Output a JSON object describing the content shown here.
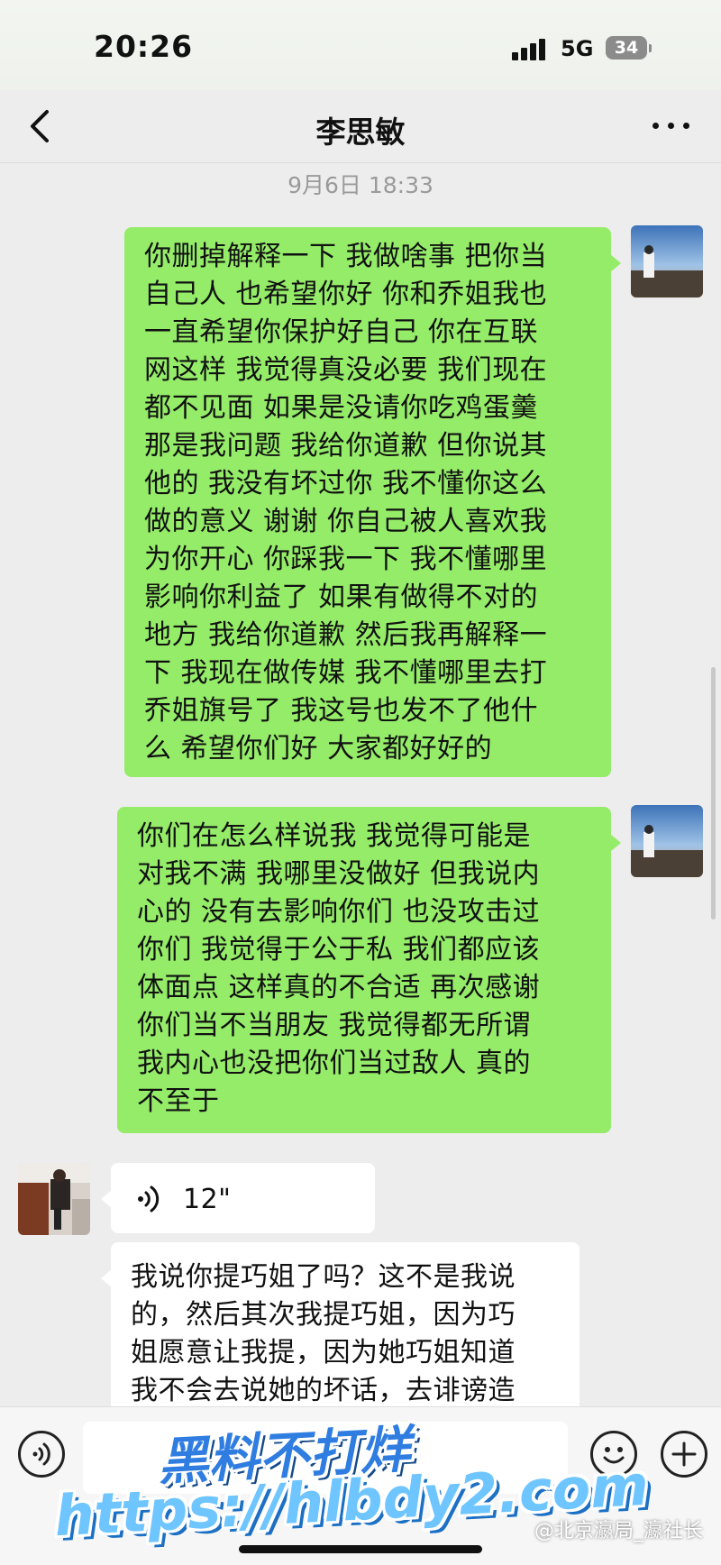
{
  "status_bar": {
    "time": "20:26",
    "network": "5G",
    "battery": "34"
  },
  "nav": {
    "title": "李思敏",
    "back_icon": "chevron-left-icon",
    "more_icon": "more-dots-icon"
  },
  "timestamp": "9月6日 18:33",
  "messages": [
    {
      "side": "sent",
      "type": "text",
      "lines": [
        "你删掉解释一下 我做啥事 把你当",
        "自己人 也希望你好 你和乔姐我也",
        "一直希望你保护好自己 你在互联",
        "网这样 我觉得真没必要 我们现在",
        "都不见面 如果是没请你吃鸡蛋羹",
        "那是我问题 我给你道歉 但你说其",
        "他的 我没有坏过你 我不懂你这么",
        "做的意义 谢谢 你自己被人喜欢我",
        "为你开心 你踩我一下 我不懂哪里",
        "影响你利益了 如果有做得不对的",
        "地方 我给你道歉 然后我再解释一",
        "下 我现在做传媒 我不懂哪里去打",
        "乔姐旗号了 我这号也发不了他什",
        "么 希望你们好 大家都好好的"
      ]
    },
    {
      "side": "sent",
      "type": "text",
      "lines": [
        "你们在怎么样说我 我觉得可能是",
        "对我不满 我哪里没做好 但我说内",
        "心的 没有去影响你们 也没攻击过",
        "你们 我觉得于公于私 我们都应该",
        "体面点 这样真的不合适 再次感谢",
        "你们当不当朋友 我觉得都无所谓",
        "我内心也没把你们当过敌人 真的",
        "不至于"
      ]
    },
    {
      "side": "received",
      "type": "voice",
      "duration": "12\""
    },
    {
      "side": "received",
      "type": "text",
      "lines": [
        "我说你提巧姐了吗？这不是我说",
        "的，然后其次我提巧姐，因为巧",
        "姐愿意让我提，因为她巧姐知道",
        "我不会去说她的坏话，去诽谤造"
      ]
    }
  ],
  "input_bar": {
    "voice_icon": "voice-input-icon",
    "emoji_icon": "emoji-icon",
    "plus_icon": "plus-icon"
  },
  "watermarks": {
    "line1": "黑料不打烊",
    "line2": "https://hlbdy2.com",
    "weibo": "@北京瀛局_瀛社长"
  },
  "colors": {
    "sent_bubble": "#95ec69",
    "received_bubble": "#ffffff",
    "background": "#ededed"
  }
}
